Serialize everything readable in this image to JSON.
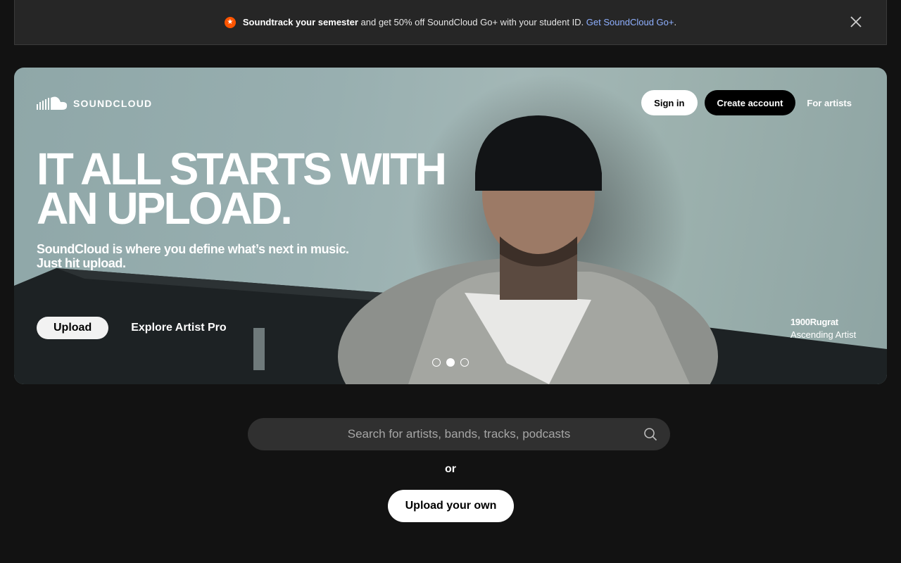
{
  "promo": {
    "bold_text": "Soundtrack your semester",
    "text": " and get 50% off SoundCloud Go+ with your student ID. ",
    "link": "Get SoundCloud Go+",
    "period": "."
  },
  "header": {
    "logo_text": "SOUNDCLOUD",
    "sign_in": "Sign in",
    "create_account": "Create account",
    "for_artists": "For artists"
  },
  "hero": {
    "headline_line1": "IT ALL STARTS WITH",
    "headline_line2": "AN UPLOAD.",
    "subline_line1": "SoundCloud is where you define what’s next in music.",
    "subline_line2": "Just hit upload.",
    "upload_button": "Upload",
    "explore_link": "Explore Artist Pro",
    "artist_name": "1900Rugrat",
    "artist_caption": "Ascending Artist",
    "carousel": {
      "slides": 3,
      "active_index": 1
    }
  },
  "search": {
    "placeholder": "Search for artists, bands, tracks, podcasts"
  },
  "or_label": "or",
  "upload_own_button": "Upload your own",
  "colors": {
    "brand_orange": "#ff5500",
    "background": "#121212",
    "link_blue": "#8fb0ff"
  }
}
